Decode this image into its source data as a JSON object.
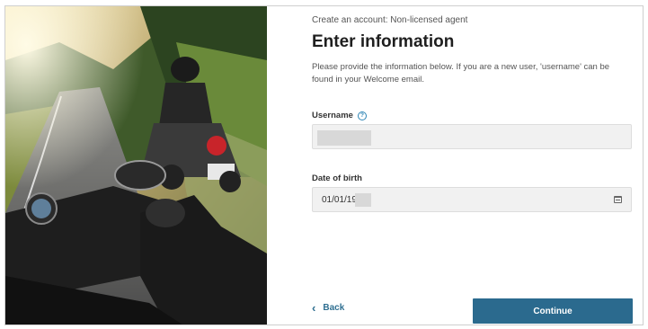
{
  "hero": {
    "image": "motorcycle-road-photo"
  },
  "form": {
    "eyebrow": "Create an account: Non-licensed agent",
    "title": "Enter information",
    "description": "Please provide the information below. If you are a new user, 'username' can be found in your Welcome email.",
    "username": {
      "label": "Username",
      "help_icon": "question-circle-icon",
      "value": ""
    },
    "dob": {
      "label": "Date of birth",
      "value": "01/01/19",
      "icon": "calendar-icon"
    }
  },
  "actions": {
    "back_label": "Back",
    "back_icon": "chevron-left-icon",
    "continue_label": "Continue"
  },
  "colors": {
    "primary": "#2b6a8e",
    "link": "#2f6f91",
    "help": "#2f86b5",
    "field_bg": "#f1f1f1"
  }
}
